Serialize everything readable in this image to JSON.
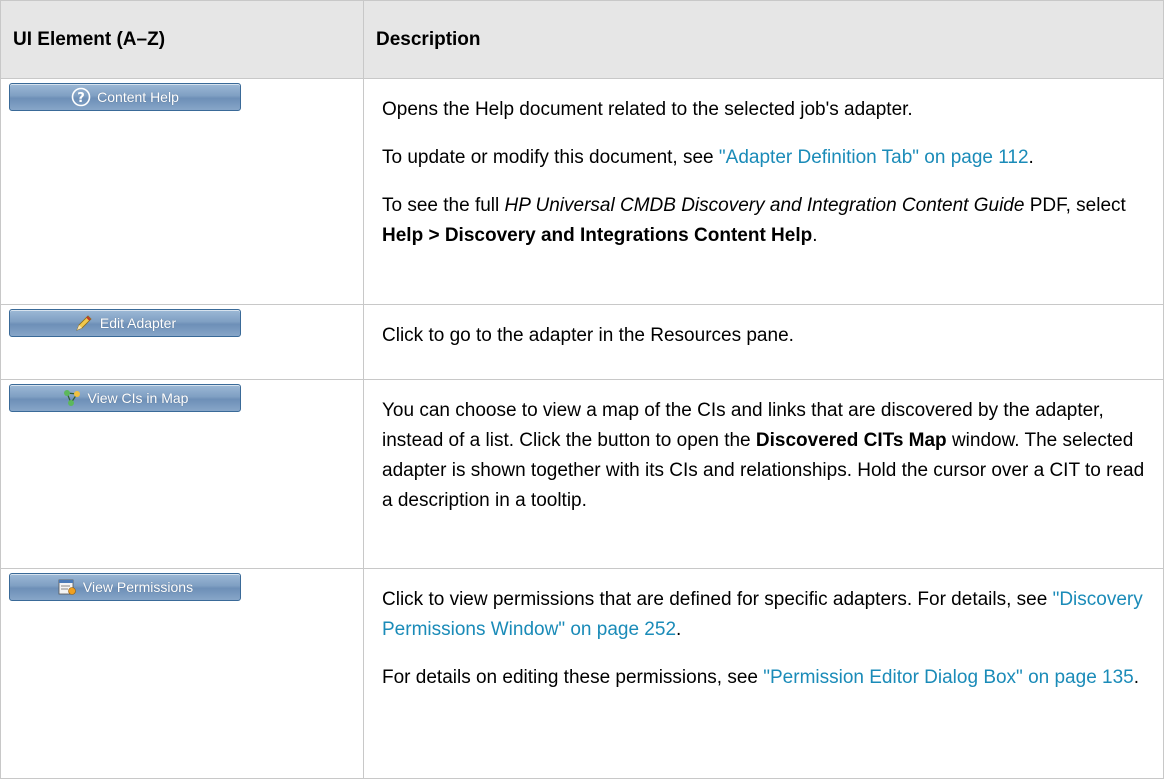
{
  "table": {
    "headers": [
      "UI Element (A–Z)",
      "Description"
    ],
    "rows": [
      {
        "button": {
          "label": "Content Help",
          "icon": "help-icon"
        },
        "paragraphs": [
          {
            "text": "Opens the Help document related to the selected job's adapter."
          },
          {
            "pre": "To update or modify this document, see ",
            "link": "\"Adapter Definition Tab\" on page 112",
            "post": "."
          },
          {
            "pre": "To see the full ",
            "italic": "HP Universal CMDB Discovery and Integration Content Guide",
            "mid": " PDF, select ",
            "bold": "Help > Discovery and Integrations Content Help",
            "post": "."
          }
        ]
      },
      {
        "button": {
          "label": "Edit Adapter",
          "icon": "pencil-icon"
        },
        "paragraphs": [
          {
            "text": "Click to go to the adapter in the Resources pane."
          }
        ]
      },
      {
        "button": {
          "label": "View CIs in Map",
          "icon": "map-icon"
        },
        "paragraphs": [
          {
            "pre": "You can choose to view a map of the CIs and links that are discovered by the adapter, instead of a list. Click the button to open the ",
            "bold": "Discovered CITs Map",
            "post": " window. The selected adapter is shown together with its CIs and relationships. Hold the cursor over a CIT to read a description in a tooltip."
          }
        ]
      },
      {
        "button": {
          "label": "View Permissions",
          "icon": "permissions-icon"
        },
        "paragraphs": [
          {
            "pre": "Click to view permissions that are defined for specific adapters. For details, see ",
            "link": "\"Discovery Permissions Window\" on page 252",
            "post": "."
          },
          {
            "pre": "For details on editing these permissions, see ",
            "link": "\"Permission Editor Dialog Box\" on page 135",
            "post": "."
          }
        ]
      }
    ]
  },
  "colors": {
    "link": "#1a8bb8",
    "header_bg": "#e6e6e6",
    "button": "#7f9fc3"
  }
}
